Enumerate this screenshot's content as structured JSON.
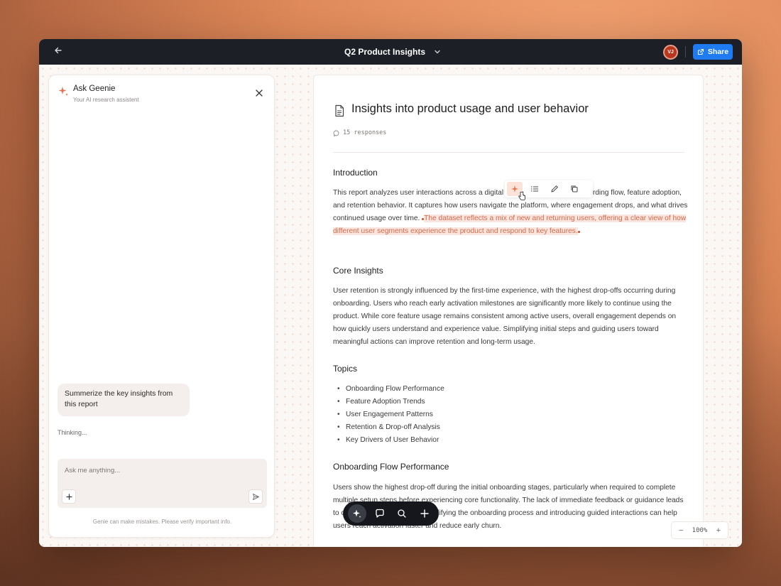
{
  "window": {
    "title": "Q2 Product Insights",
    "back_icon": "arrow-left-icon",
    "avatar_initials": "VJ",
    "share_label": "Share",
    "colors": {
      "accent": "#1e7bf0",
      "topbar": "#1c1f26",
      "highlight": "#d46a4c",
      "avatar": "#b8361e"
    }
  },
  "genie": {
    "title": "Ask Geenie",
    "subtitle": "Your AI research assistent",
    "user_message": "Summerize the key insights from this report",
    "status": "Thinking...",
    "input_placeholder": "Ask me anything...",
    "disclaimer": "Genie can make mistakes. Please verify important info."
  },
  "document": {
    "heading": "Insights into product usage and user behavior",
    "responses": "15 responses",
    "sections": {
      "intro_title": "Introduction",
      "intro_text": "This report analyzes user interactions across a digital product, focusing on onboarding flow, feature adoption, and retention behavior. It captures how users navigate the platform, where engagement drops, and what drives continued usage over time.",
      "intro_highlight": "The dataset reflects a mix of new and returning users, offering a clear view of how different user segments experience the product and respond to key features.",
      "core_title": "Core Insights",
      "core_text": "User retention is strongly influenced by the first-time experience, with the highest drop-offs occurring during onboarding. Users who reach early activation milestones are significantly more likely to continue using the product. While core feature usage remains consistent among active users, overall engagement depends on how quickly users understand and experience value. Simplifying initial steps and guiding users toward meaningful actions can improve retention and long-term usage.",
      "topics_title": "Topics",
      "topics": [
        "Onboarding Flow Performance",
        "Feature Adoption Trends",
        "User Engagement Patterns",
        "Retention & Drop-off Analysis",
        "Key Drivers of User Behavior"
      ],
      "onboarding_title": "Onboarding Flow Performance",
      "onboarding_text": "Users show the highest drop-off during the initial onboarding stages, particularly when required to complete multiple setup steps before experiencing core functionality. The lack of immediate feedback or guidance leads to confusion and early exit. Simplifying the onboarding process and introducing guided interactions can help users reach activation faster and reduce early churn."
    }
  },
  "selection_toolbar": [
    "sparkle-icon",
    "list-icon",
    "pencil-icon",
    "copy-icon"
  ],
  "bottom_toolbar": [
    "sparkle-icon",
    "comment-icon",
    "search-icon",
    "plus-icon"
  ],
  "zoom": {
    "minus": "−",
    "level": "100%",
    "plus": "+"
  }
}
